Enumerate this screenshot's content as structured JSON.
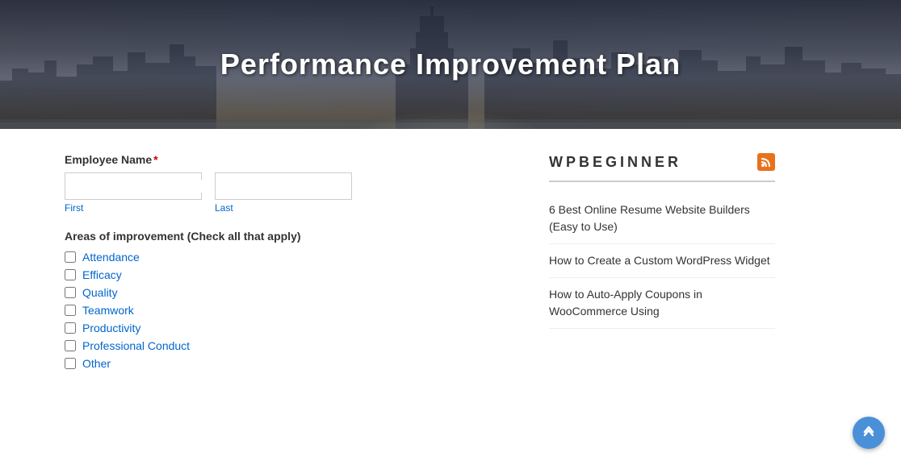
{
  "hero": {
    "title": "Performance Improvement Plan"
  },
  "form": {
    "employee_name_label": "Employee Name",
    "required_marker": "*",
    "first_label": "First",
    "last_label": "Last",
    "areas_label": "Areas of improvement (Check all that apply)",
    "checkboxes": [
      {
        "label": "Attendance"
      },
      {
        "label": "Efficacy"
      },
      {
        "label": "Quality"
      },
      {
        "label": "Teamwork"
      },
      {
        "label": "Productivity"
      },
      {
        "label": "Professional Conduct"
      },
      {
        "label": "Other"
      }
    ]
  },
  "sidebar": {
    "brand": "WPBEGINNER",
    "rss_icon": "rss",
    "links": [
      {
        "text": "6 Best Online Resume Website Builders (Easy to Use)"
      },
      {
        "text": "How to Create a Custom WordPress Widget"
      },
      {
        "text": "How to Auto-Apply Coupons in WooCommerce Using"
      }
    ]
  },
  "scroll_top": {
    "icon": "▲▲"
  }
}
